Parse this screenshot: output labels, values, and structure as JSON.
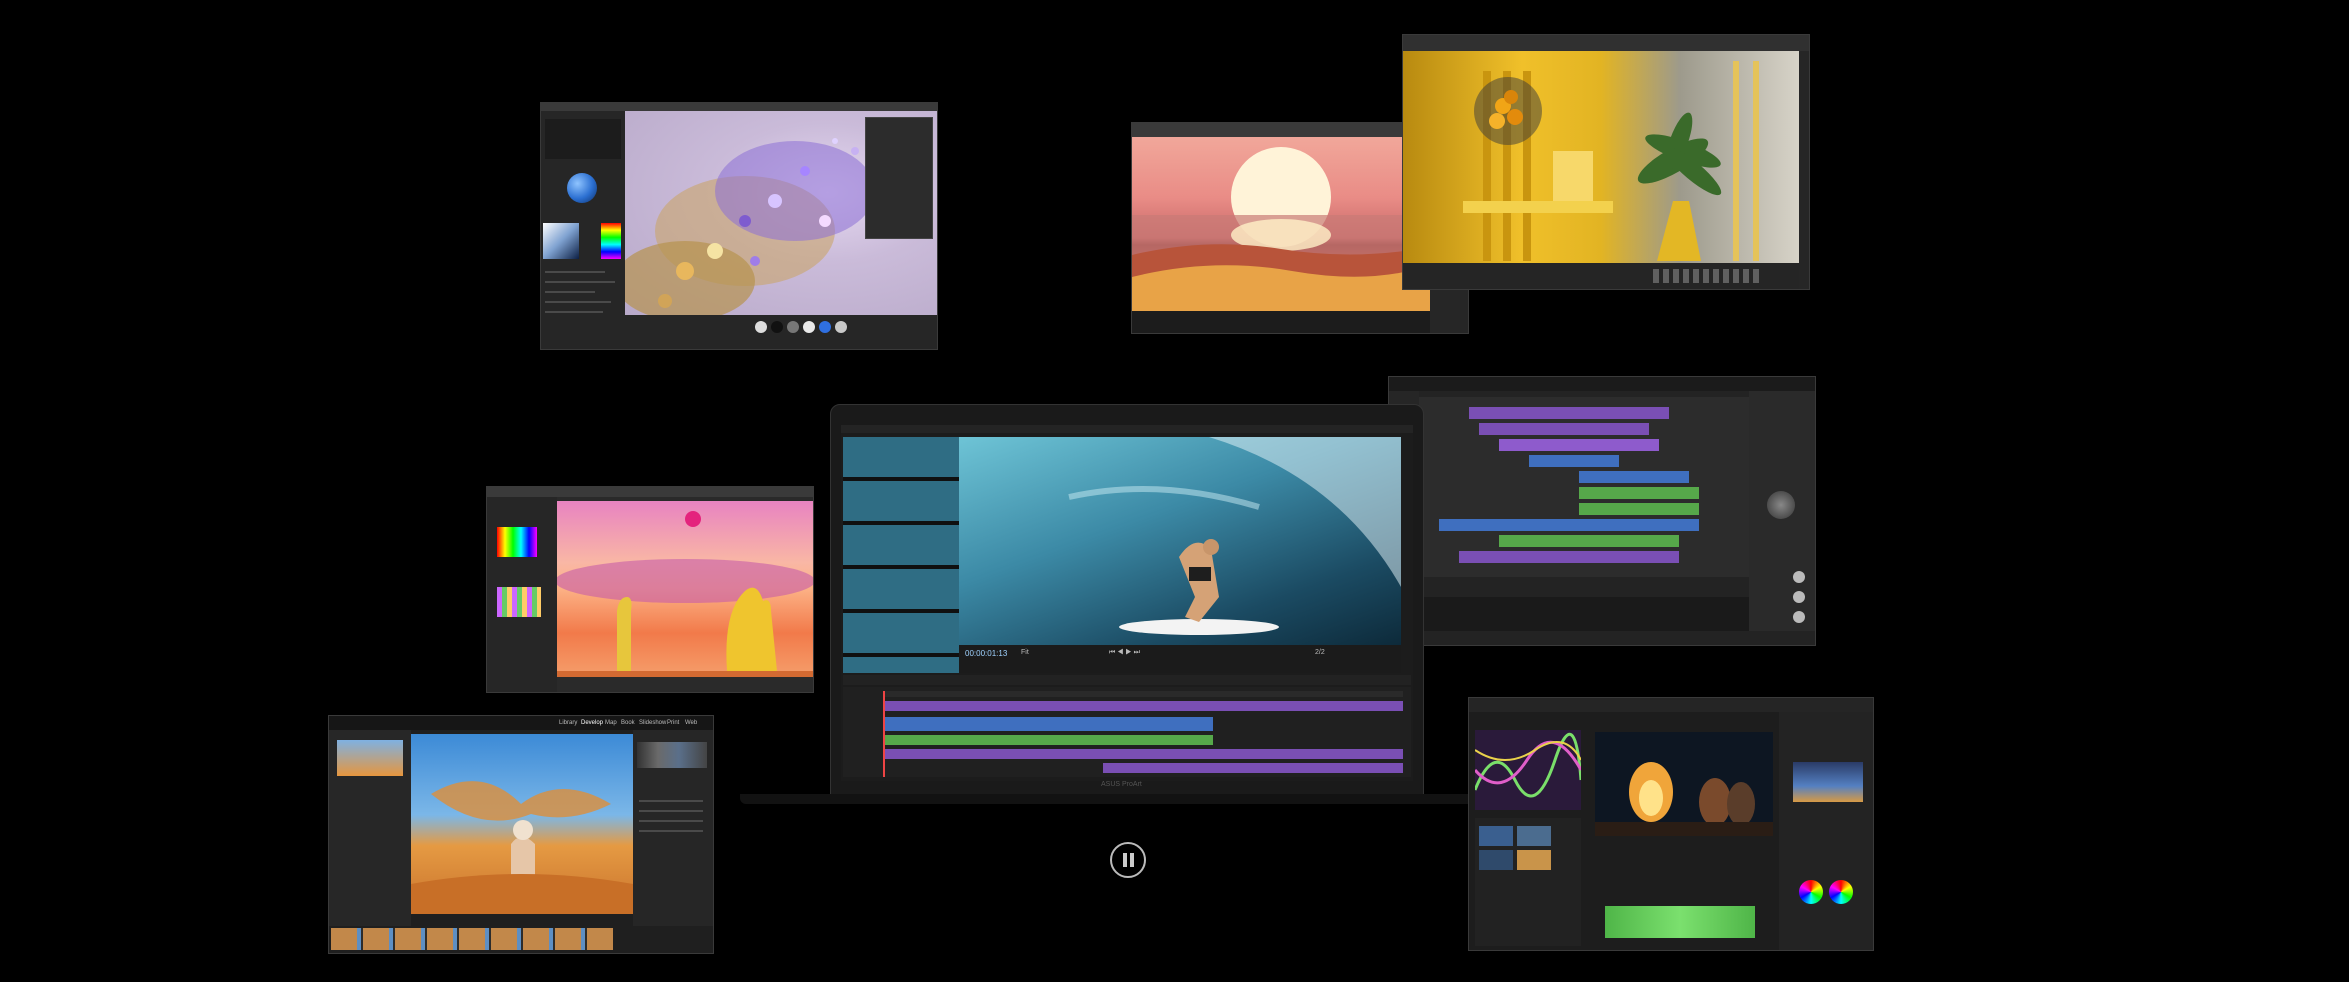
{
  "timecode": "00:00:01:13",
  "viewer_fit": "Fit",
  "viewer_page": "2/2",
  "laptop_brand": "ASUS ProArt",
  "lightroom_modules": [
    "Library",
    "Develop",
    "Map",
    "Book",
    "Slideshow",
    "Print",
    "Web"
  ],
  "lightroom_active_module": "Develop",
  "playback": {
    "state": "playing",
    "pause_icon": "pause-icon"
  },
  "accent_colors": {
    "timeline_purple": "#7a4fb4",
    "timeline_green": "#56a84a",
    "timeline_blue": "#3f6fbf",
    "waveform_green": "#5fcf5a"
  }
}
